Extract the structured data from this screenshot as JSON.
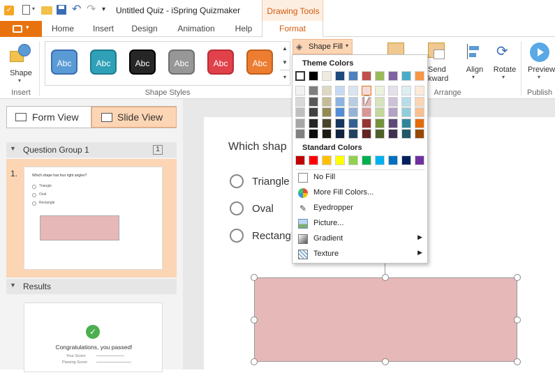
{
  "titlebar": {
    "title": "Untitled Quiz - iSpring Quizmaker",
    "qat_more": "▾"
  },
  "context_tab": {
    "label": "Drawing Tools"
  },
  "ribbon_tabs": [
    {
      "label": "Home"
    },
    {
      "label": "Insert"
    },
    {
      "label": "Design"
    },
    {
      "label": "Animation"
    },
    {
      "label": "Help"
    },
    {
      "label": "Format"
    }
  ],
  "ribbon": {
    "shape_button": "Shape",
    "insert_group": "Insert",
    "styles_group": "Shape Styles",
    "styles": [
      {
        "label": "Abc",
        "color": "#5b9bd5"
      },
      {
        "label": "Abc",
        "color": "#2fa0b8"
      },
      {
        "label": "Abc",
        "color": "#262626"
      },
      {
        "label": "Abc",
        "color": "#979797"
      },
      {
        "label": "Abc",
        "color": "#e0414a"
      },
      {
        "label": "Abc",
        "color": "#ed7d31"
      }
    ],
    "shape_fill": "Shape Fill",
    "send_backward_1": "Send",
    "send_backward_2": "kward",
    "align": "Align",
    "rotate": "Rotate",
    "arrange_group": "Arrange",
    "preview": "Preview",
    "publish_group": "Publish"
  },
  "views": {
    "form": "Form View",
    "slide": "Slide View"
  },
  "sidebar": {
    "group_title": "Question Group 1",
    "group_count": "1",
    "slide_number": "1.",
    "thumb_question": "Which shape has four right angles?",
    "thumb_options": [
      "Triangle",
      "Oval",
      "Rectangle"
    ],
    "results": "Results",
    "result_text": "Congratulations, you passed!",
    "your_score": "Your Score:",
    "passing_score": "Passing Score:"
  },
  "slide": {
    "question": "Which shap",
    "options": [
      "Triangle",
      "Oval",
      "Rectangl"
    ]
  },
  "dropdown": {
    "theme_title": "Theme Colors",
    "standard_title": "Standard Colors",
    "no_fill": "No Fill",
    "more_colors": "More Fill Colors...",
    "eyedropper": "Eyedropper",
    "picture": "Picture...",
    "gradient": "Gradient",
    "texture": "Texture",
    "submenu_arrow": "▶"
  },
  "colors": {
    "accent_orange": "#e8730e",
    "selected_fill": "#fcd5b4",
    "shape_fill": "#e6b8b7"
  },
  "theme_colors": [
    [
      "#ffffff",
      "#f2f2f2",
      "#d9d9d9",
      "#bfbfbf",
      "#a6a6a6",
      "#808080"
    ],
    [
      "#000000",
      "#7f7f7f",
      "#595959",
      "#404040",
      "#262626",
      "#0d0d0d"
    ],
    [
      "#eeece1",
      "#ddd9c3",
      "#c4bd97",
      "#948a54",
      "#4a452a",
      "#1e1c11"
    ],
    [
      "#1f497d",
      "#c6d9f0",
      "#8db3e2",
      "#548dd4",
      "#17365d",
      "#0f243e"
    ],
    [
      "#4f81bd",
      "#dbe5f1",
      "#b8cce4",
      "#95b3d7",
      "#366092",
      "#244061"
    ],
    [
      "#c0504d",
      "#f2dcdb",
      "#e6b8b7",
      "#d99694",
      "#953734",
      "#632423"
    ],
    [
      "#9bbb59",
      "#ebf1dd",
      "#d7e3bc",
      "#c3d69b",
      "#76923c",
      "#4f6128"
    ],
    [
      "#8064a2",
      "#e5e0ec",
      "#ccc1d9",
      "#b2a2c7",
      "#5f497a",
      "#3f3151"
    ],
    [
      "#4bacc6",
      "#dbeef3",
      "#b7dde8",
      "#92cddc",
      "#31859b",
      "#205867"
    ],
    [
      "#f79646",
      "#fdeada",
      "#fbd5b5",
      "#fac08f",
      "#e36c09",
      "#974806"
    ]
  ],
  "standard_colors": [
    "#c00000",
    "#ff0000",
    "#ffc000",
    "#ffff00",
    "#92d050",
    "#00b050",
    "#00b0f0",
    "#0070c0",
    "#002060",
    "#7030a0"
  ]
}
